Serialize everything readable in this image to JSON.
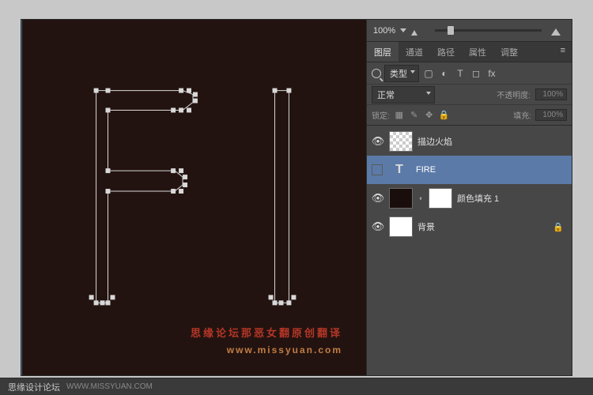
{
  "zoom": {
    "value": "100%"
  },
  "tabs": {
    "layers": "图层",
    "channels": "通道",
    "paths": "路径",
    "properties": "属性",
    "adjustments": "调整"
  },
  "filter": {
    "type_label": "类型"
  },
  "blend": {
    "mode": "正常",
    "opacity_label": "不透明度:",
    "opacity_value": "100%",
    "lock_label": "锁定:",
    "fill_label": "填充:",
    "fill_value": "100%"
  },
  "layers_list": [
    {
      "name": "描边火焰",
      "eye": true,
      "thumb": "checker"
    },
    {
      "name": "FIRE",
      "eye": false,
      "thumb": "text"
    },
    {
      "name": "颜色填充 1",
      "eye": true,
      "thumb": "dark",
      "mask": true
    },
    {
      "name": "背景",
      "eye": true,
      "thumb": "white",
      "locked": true
    }
  ],
  "watermark": {
    "line1": "思缘论坛那恶女翻原创翻译",
    "line2": "www.missyuan.com"
  },
  "footer": {
    "site": "思缘设计论坛",
    "url": "WWW.MISSYUAN.COM"
  },
  "icons": {
    "menu": "≡",
    "image": "▢",
    "circle": "◐",
    "text": "T",
    "shape": "◻",
    "fx": "fx",
    "pixel": "▦",
    "brush": "✎",
    "arrows": "✥",
    "lock": "🔒",
    "eye": "👁",
    "link": "⬫"
  }
}
